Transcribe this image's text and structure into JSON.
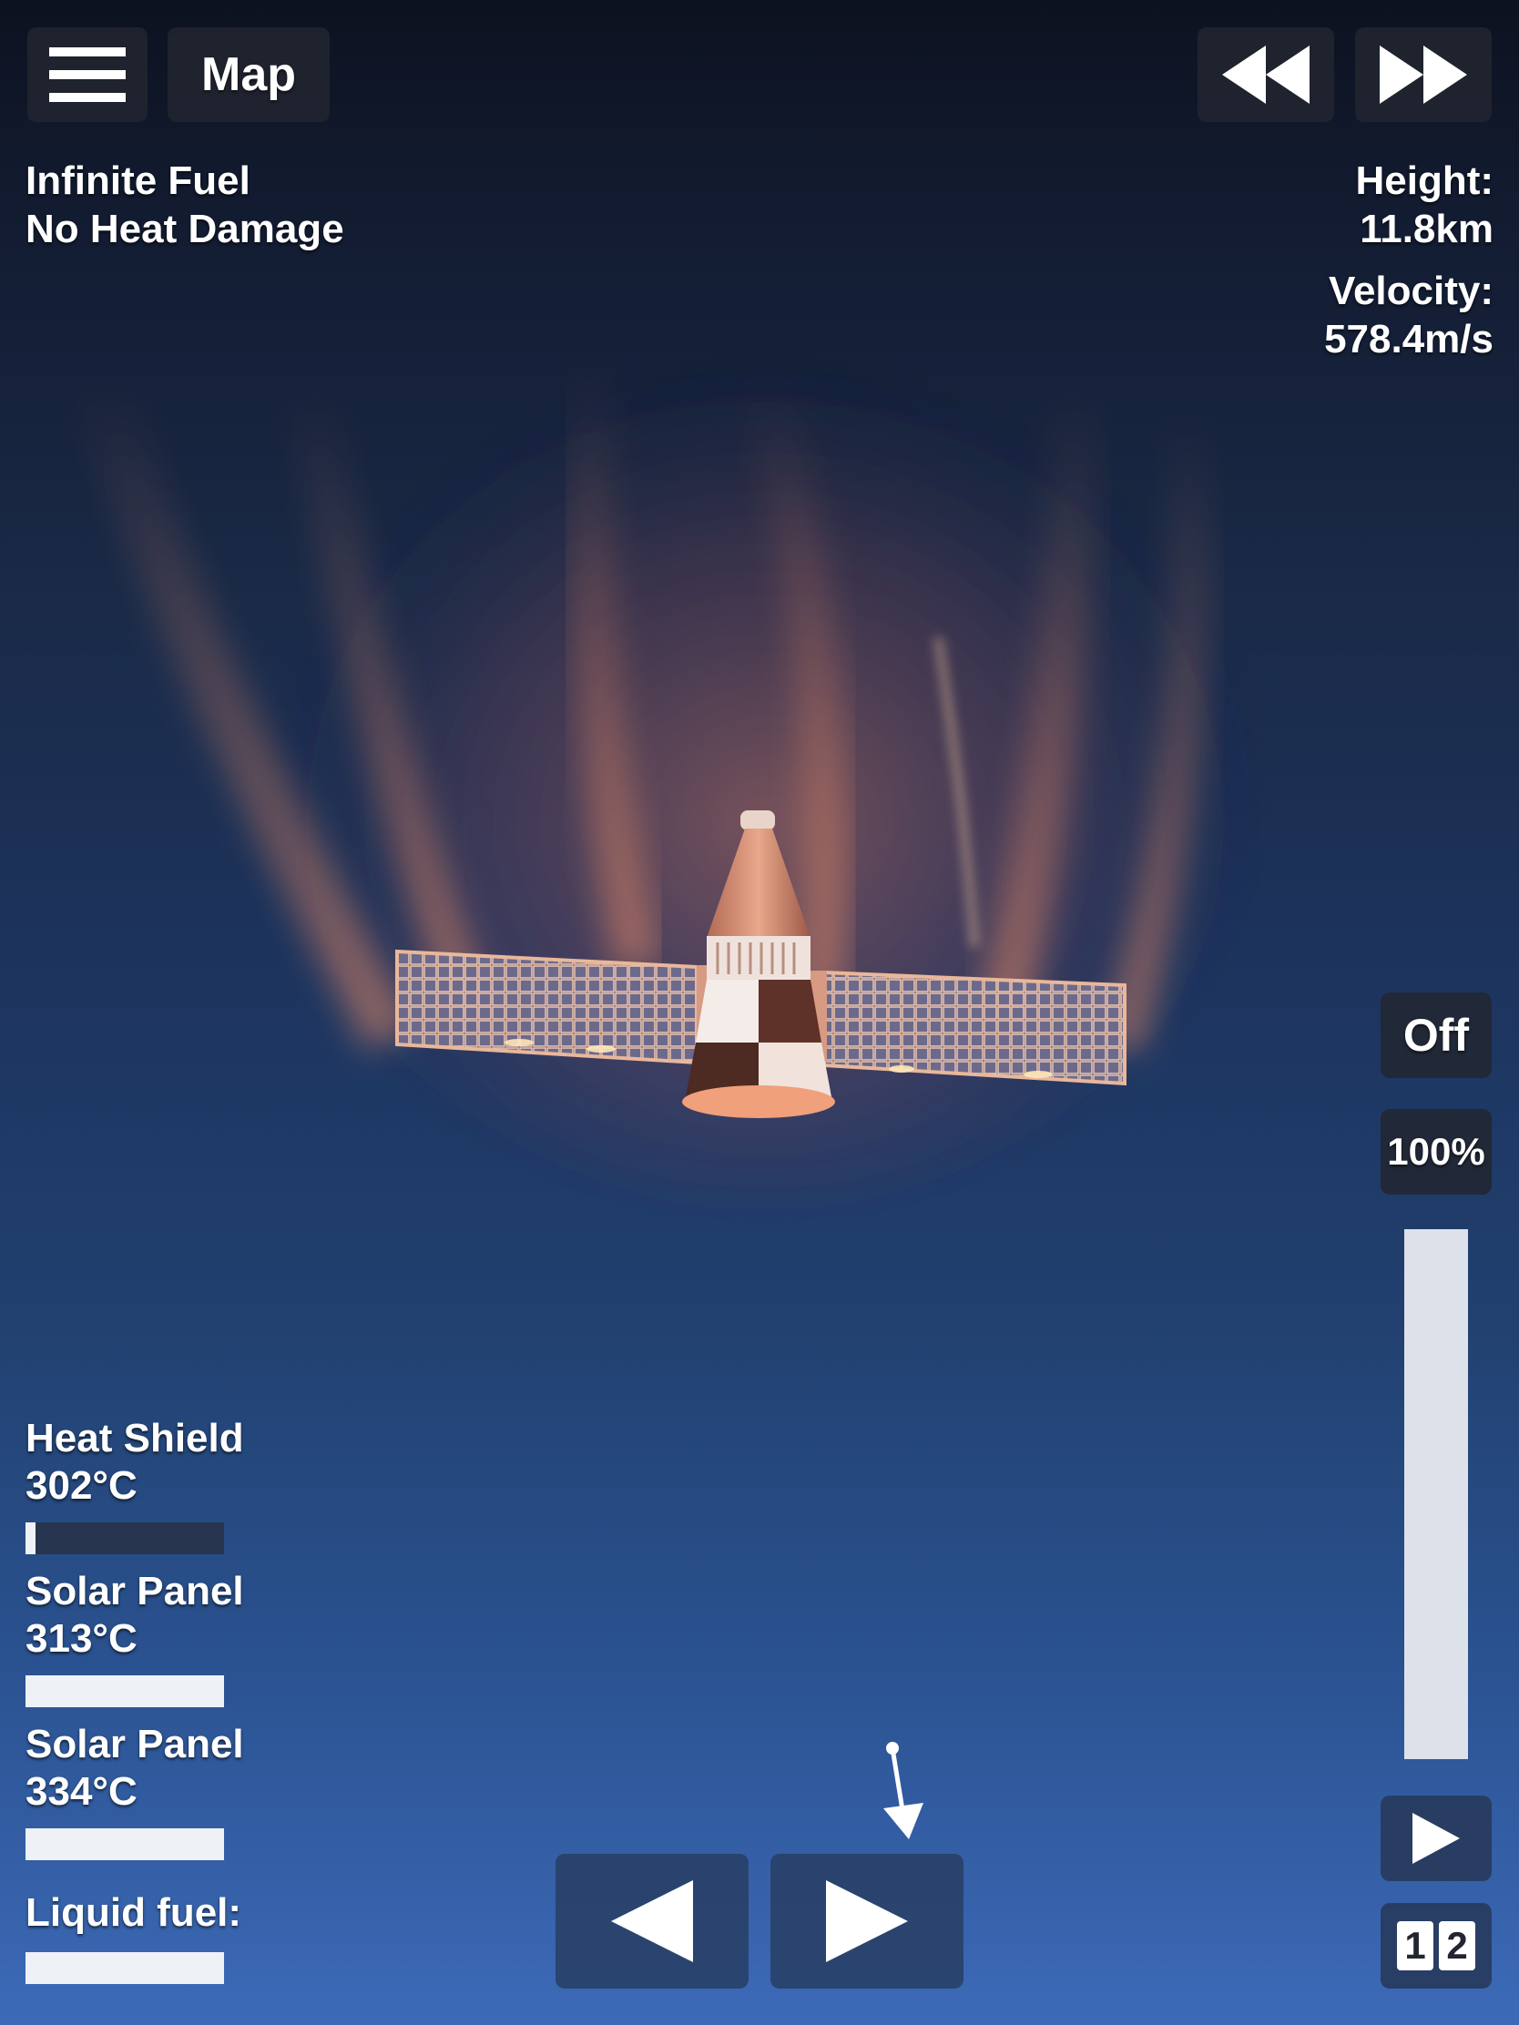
{
  "top_left": {
    "menu_icon": "hamburger-menu-icon",
    "map_label": "Map"
  },
  "time_controls": {
    "rewind_icon": "rewind-icon",
    "fast_forward_icon": "fast-forward-icon"
  },
  "cheats": {
    "line1": "Infinite Fuel",
    "line2": "No Heat Damage"
  },
  "telemetry": {
    "height_label": "Height:",
    "height_value": "11.8km",
    "velocity_label": "Velocity:",
    "velocity_value": "578.4m/s"
  },
  "throttle": {
    "toggle_label": "Off",
    "percent_label": "100%",
    "level": 1.0
  },
  "parts": [
    {
      "name": "Heat Shield",
      "temp": "302°C",
      "heat_fraction": 0.05
    },
    {
      "name": "Solar Panel",
      "temp": "313°C",
      "heat_fraction": 1.0
    },
    {
      "name": "Solar Panel",
      "temp": "334°C",
      "heat_fraction": 1.0
    }
  ],
  "fuel": {
    "label": "Liquid fuel:",
    "fraction": 1.0
  },
  "bottom_controls": {
    "rotate_left_icon": "arrow-left-icon",
    "rotate_right_icon": "arrow-right-icon",
    "stage_icon": "play-icon",
    "camera_icon": "camera-1-2-icon",
    "camera_digit_1": "1",
    "camera_digit_2": "2"
  },
  "colors": {
    "sky_top": "#0d1220",
    "sky_bottom": "#3d6ab8",
    "button_bg": "#222630",
    "bar_bg": "#27344e",
    "bar_fill": "#eef1f6",
    "plasma": "#c4705c"
  }
}
